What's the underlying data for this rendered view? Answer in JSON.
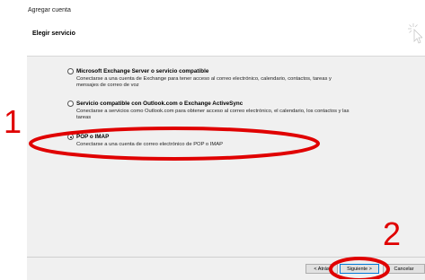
{
  "window": {
    "title": "Agregar cuenta"
  },
  "page": {
    "title": "Elegir servicio"
  },
  "options": [
    {
      "label": "Microsoft Exchange Server o servicio compatible",
      "desc_line1": "Conectarse a una cuenta de Exchange para tener acceso al correo electrónico, calendario, contactos, tareas y",
      "desc_line2": "mensajes de correo de voz",
      "selected": false
    },
    {
      "label": "Servicio compatible con Outlook.com o Exchange ActiveSync",
      "desc_line1": "Conectarse a servicios como Outlook.com para obtener acceso al correo electrónico, el calendario, los contactos y las",
      "desc_line2": "tareas",
      "selected": false
    },
    {
      "label": "POP o IMAP",
      "desc_line1": "Conectarse a una cuenta de correo electrónico de POP o IMAP",
      "desc_line2": "",
      "selected": true
    }
  ],
  "buttons": {
    "back": "< Atrás",
    "next": "Siguiente >",
    "cancel": "Cancelar"
  },
  "annotations": {
    "first": "1",
    "second": "2"
  },
  "colors": {
    "annotation": "#e00000",
    "panel": "#f0f0f0"
  }
}
